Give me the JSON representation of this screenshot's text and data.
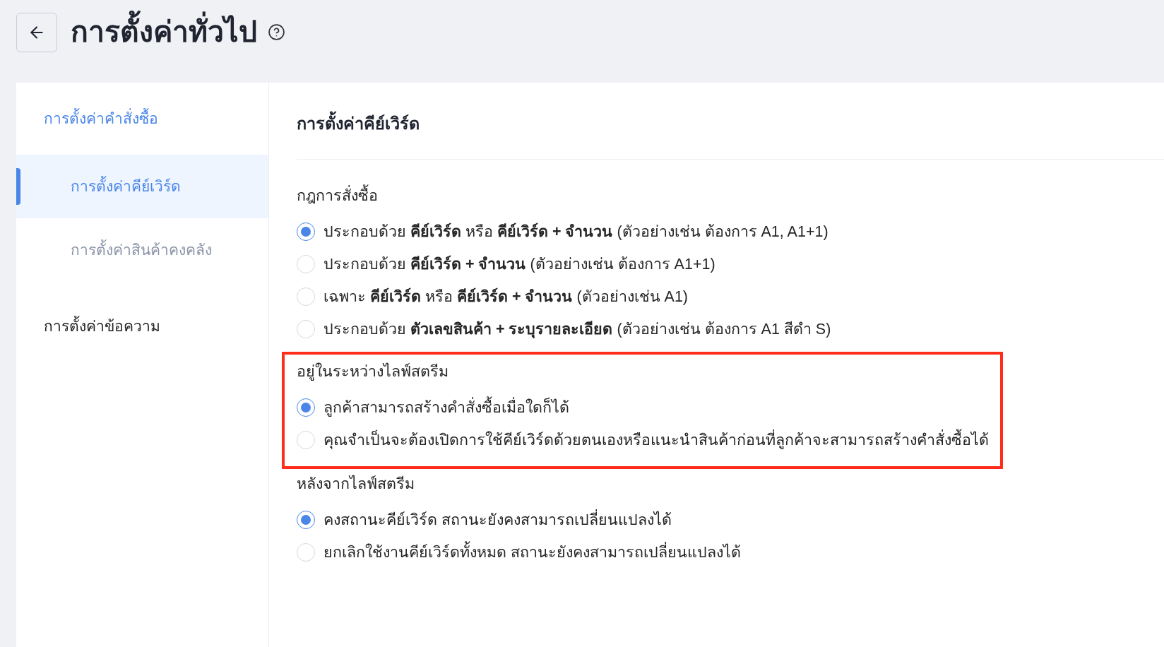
{
  "header": {
    "title": "การตั้งค่าทั่วไป"
  },
  "sidebar": {
    "items": [
      {
        "label": "การตั้งค่าคำสั่งซื้อ",
        "selected": false,
        "children": [
          {
            "label": "การตั้งค่าคีย์เวิร์ด",
            "selected": true
          },
          {
            "label": "การตั้งค่าสินค้าคงคลัง",
            "selected": false
          }
        ]
      },
      {
        "label": "การตั้งค่าข้อความ",
        "selected": false
      }
    ]
  },
  "panel": {
    "title": "การตั้งค่าคีย์เวิร์ด",
    "sections": [
      {
        "label": "กฎการสั่งซื้อ",
        "highlighted": false,
        "options": [
          {
            "text": "ประกอบด้วย **คีย์เวิร์ด** หรือ **คีย์เวิร์ด + จำนวน** (ตัวอย่างเช่น ต้องการ A1, A1+1)",
            "selected": true
          },
          {
            "text": "ประกอบด้วย **คีย์เวิร์ด + จำนวน** (ตัวอย่างเช่น ต้องการ A1+1)",
            "selected": false
          },
          {
            "text": "เฉพาะ **คีย์เวิร์ด** หรือ **คีย์เวิร์ด + จำนวน** (ตัวอย่างเช่น A1)",
            "selected": false
          },
          {
            "text": "ประกอบด้วย **ตัวเลขสินค้า + ระบุรายละเอียด** (ตัวอย่างเช่น ต้องการ A1 สีดำ S)",
            "selected": false
          }
        ]
      },
      {
        "label": "อยู่ในระหว่างไลฟ์สตรีม",
        "highlighted": true,
        "options": [
          {
            "text": "ลูกค้าสามารถสร้างคำสั่งซื้อเมื่อใดก็ได้",
            "selected": true
          },
          {
            "text": "คุณจำเป็นจะต้องเปิดการใช้คีย์เวิร์ดด้วยตนเองหรือแนะนำสินค้าก่อนที่ลูกค้าจะสามารถสร้างคำสั่งซื้อได้",
            "selected": false
          }
        ]
      },
      {
        "label": "หลังจากไลฟ์สตรีม",
        "highlighted": false,
        "options": [
          {
            "text": "คงสถานะคีย์เวิร์ด สถานะยังคงสามารถเปลี่ยนแปลงได้",
            "selected": true
          },
          {
            "text": "ยกเลิกใช้งานคีย์เวิร์ดทั้งหมด สถานะยังคงสามารถเปลี่ยนแปลงได้",
            "selected": false
          }
        ]
      }
    ]
  }
}
